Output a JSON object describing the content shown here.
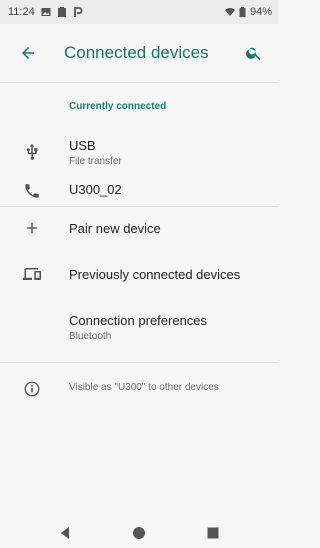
{
  "status_bar": {
    "time": "11:24",
    "battery": "94%",
    "icons": [
      "image-icon",
      "clipboard-icon",
      "p-icon",
      "wifi-icon",
      "battery-icon"
    ]
  },
  "app_bar": {
    "title": "Connected devices",
    "back_icon": "arrow-back-icon",
    "search_icon": "search-icon",
    "accent_color": "#14746f"
  },
  "section": {
    "header": "Currently connected"
  },
  "devices": [
    {
      "icon": "usb-icon",
      "title": "USB",
      "subtitle": "File transfer"
    },
    {
      "icon": "phone-icon",
      "title": "U300_02"
    }
  ],
  "actions": [
    {
      "icon": "plus-icon",
      "label": "Pair new device"
    },
    {
      "icon": "devices-icon",
      "label": "Previously connected devices"
    },
    {
      "label": "Connection preferences",
      "subtitle": "Bluetooth"
    }
  ],
  "info": {
    "icon": "info-icon",
    "text": "Visible as \"U300\" to other devices"
  },
  "nav_bar": {
    "buttons": [
      "back-triangle-icon",
      "home-circle-icon",
      "recents-square-icon"
    ]
  }
}
